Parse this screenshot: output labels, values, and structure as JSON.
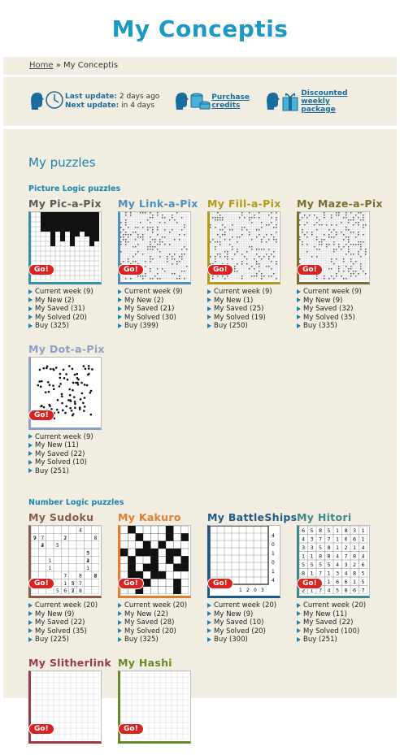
{
  "header": {
    "logo": "My Conceptis"
  },
  "breadcrumb": {
    "home": "Home",
    "sep": "»",
    "current": "My Conceptis"
  },
  "info": {
    "last_label": "Last update:",
    "last_value": "2 days ago",
    "next_label": "Next update:",
    "next_value": "in 4 days",
    "purchase": "Purchase credits",
    "package": "Discounted weekly package"
  },
  "main": {
    "title": "My puzzles",
    "sections": [
      {
        "title": "Picture Logic puzzles",
        "puzzles": [
          {
            "name": "My Pic-a-Pix",
            "color": "#5b5b5b",
            "border": "#3a8fa8",
            "links": [
              "Current week (9)",
              "My New (2)",
              "My Saved (31)",
              "My Solved (20)",
              "Buy (325)"
            ]
          },
          {
            "name": "My Link-a-Pix",
            "color": "#4c8fc1",
            "border": "#4c8fc1",
            "links": [
              "Current week (9)",
              "My New (2)",
              "My Saved (21)",
              "My Solved (30)",
              "Buy (399)"
            ]
          },
          {
            "name": "My Fill-a-Pix",
            "color": "#b29b1a",
            "border": "#b29b1a",
            "links": [
              "Current week (9)",
              "My New (1)",
              "My Saved (25)",
              "My Solved (19)",
              "Buy (250)"
            ]
          },
          {
            "name": "My Maze-a-Pix",
            "color": "#7a6f2c",
            "border": "#7a6f2c",
            "links": [
              "Current week (9)",
              "My New (9)",
              "My Saved (32)",
              "My Solved (35)",
              "Buy (335)"
            ]
          },
          {
            "name": "My Dot-a-Pix",
            "color": "#8aa2c8",
            "border": "#8aa2c8",
            "links": [
              "Current week (9)",
              "My New (11)",
              "My Saved (22)",
              "My Solved (10)",
              "Buy (251)"
            ]
          }
        ]
      },
      {
        "title": "Number Logic puzzles",
        "puzzles": [
          {
            "name": "My Sudoku",
            "color": "#8a5a4a",
            "border": "#8a5a4a",
            "links": [
              "Current week (20)",
              "My New (9)",
              "My Saved (22)",
              "My Solved (35)",
              "Buy (225)"
            ]
          },
          {
            "name": "My Kakuro",
            "color": "#e07d2e",
            "border": "#e07d2e",
            "links": [
              "Current week (20)",
              "My New (22)",
              "My Saved (28)",
              "My Solved (20)",
              "Buy (325)"
            ]
          },
          {
            "name": "My BattleShips",
            "color": "#1c5a8c",
            "border": "#1c5a8c",
            "links": [
              "Current week (20)",
              "My New (9)",
              "My Saved (10)",
              "My Solved (20)",
              "Buy (300)"
            ]
          },
          {
            "name": "My Hitori",
            "color": "#3c8a8c",
            "border": "#3c8a8c",
            "links": [
              "Current week (20)",
              "My New (11)",
              "My Saved (22)",
              "My Solved (100)",
              "Buy (251)"
            ]
          },
          {
            "name": "My Slitherlink",
            "color": "#9a3a4a",
            "border": "#9a3a4a",
            "links": []
          },
          {
            "name": "My Hashi",
            "color": "#6a8a2a",
            "border": "#6a8a2a",
            "links": []
          }
        ]
      }
    ],
    "go_label": "Go!"
  }
}
